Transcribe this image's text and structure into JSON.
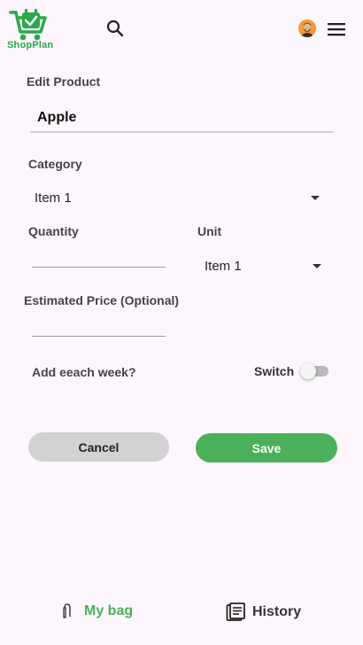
{
  "header": {
    "logo_text": "ShopPlan",
    "logo_icon": "shopping-cart-check-icon",
    "search_icon": "search-icon",
    "avatar_icon": "user-avatar",
    "menu_icon": "hamburger-menu-icon",
    "brand_color": "#2aa84a"
  },
  "form": {
    "title": "Edit Product",
    "product_name": "Apple",
    "category": {
      "label": "Category",
      "selected": "Item 1"
    },
    "quantity": {
      "label": "Quantity",
      "value": ""
    },
    "unit": {
      "label": "Unit",
      "selected": "Item 1"
    },
    "price": {
      "label": "Estimated Price (Optional)",
      "value": ""
    },
    "weekly": {
      "label": "Add eeach week?",
      "switch_label": "Switch",
      "on": false
    }
  },
  "actions": {
    "cancel_label": "Cancel",
    "save_label": "Save",
    "save_color": "#4bb05a",
    "cancel_color": "#d2d2d2"
  },
  "bottom_nav": {
    "items": [
      {
        "label": "My bag",
        "icon": "shopping-bag-icon",
        "active": true
      },
      {
        "label": "History",
        "icon": "history-list-icon",
        "active": false
      }
    ]
  }
}
